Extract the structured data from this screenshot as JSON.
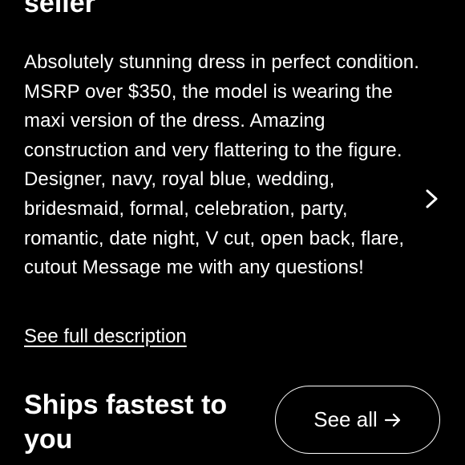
{
  "header": {
    "title_fragment": "seller"
  },
  "description": {
    "text": "Absolutely stunning dress in perfect condition. MSRP over $350, the model is wearing the maxi version of the dress. Amazing construction and very flattering to the figure. Designer, navy, royal blue, wedding, bridesmaid, formal, celebration, party, romantic, date night, V cut, open back, flare, cutout Message me with any questions!",
    "see_full_label": "See full description",
    "next_icon": "chevron-right-icon"
  },
  "shipping": {
    "title": "Ships fastest to you",
    "see_all_label": "See all",
    "see_all_icon": "arrow-right-icon"
  },
  "colors": {
    "background": "#000000",
    "text": "#ffffff"
  }
}
